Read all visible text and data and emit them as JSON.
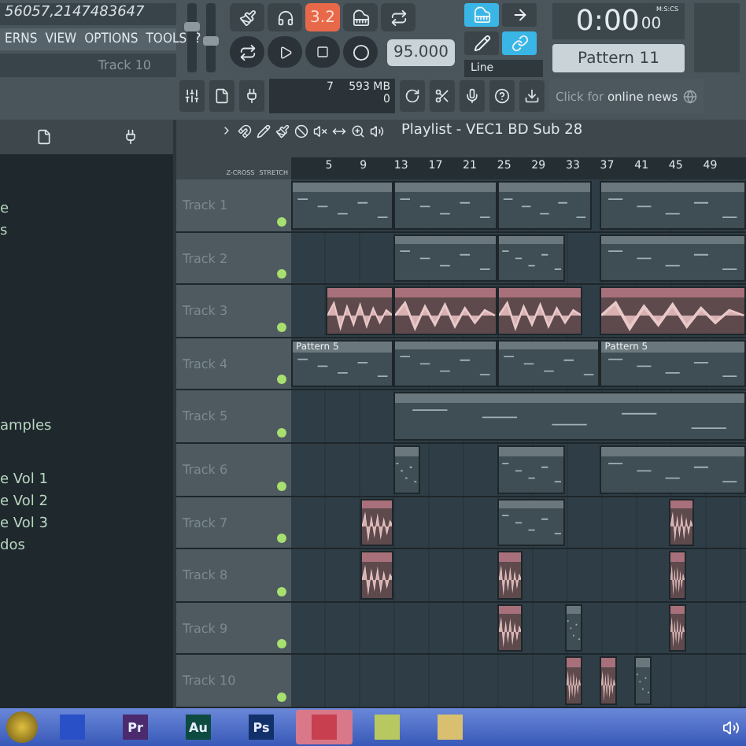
{
  "top_panel": {
    "hint_value": "56057,2147483647",
    "menu": [
      "ERNS",
      "VIEW",
      "OPTIONS",
      "TOOLS",
      "?"
    ],
    "hint_bar": "Track 10"
  },
  "sliders": [
    {
      "level": 0.65
    },
    {
      "level": 0.45
    }
  ],
  "transport": {
    "buttons": [
      {
        "on": false
      },
      {
        "on": false
      },
      {
        "label": "3.2",
        "on": true
      },
      {
        "on": false
      },
      {
        "on": false
      }
    ],
    "tempo": "95.000"
  },
  "tools": {
    "buttons": [
      {
        "on": true
      },
      {
        "on": false
      },
      {
        "on": false
      },
      {
        "on": true
      }
    ],
    "snap": "Line"
  },
  "clock": {
    "time": "0:00",
    "centis": "00",
    "unit": "M:S:CS"
  },
  "pattern": {
    "name": "Pattern 11"
  },
  "meters": {
    "cpu": "7",
    "memory": "593 MB",
    "polyphony": "0"
  },
  "news": "Click for **online news**",
  "browser": {
    "items": [
      {
        "label": "e"
      },
      {
        "label": "s"
      },
      {
        "label": "amples"
      },
      {
        "label": "e Vol 1"
      },
      {
        "label": "e Vol 2"
      },
      {
        "label": "e Vol 3"
      },
      {
        "label": "dos"
      }
    ]
  },
  "playlist": {
    "title": "Playlist - VEC1 BD Sub 28",
    "header_labels": [
      "Z-CROSS",
      "STRETCH"
    ],
    "ruler": [
      "5",
      "9",
      "13",
      "17",
      "21",
      "25",
      "29",
      "33",
      "37",
      "41",
      "45",
      "49"
    ],
    "tracks": [
      {
        "name": "Track 1",
        "clips": [
          {
            "kind": "pattern"
          },
          {
            "kind": "pattern"
          },
          {
            "kind": "pattern"
          },
          {
            "kind": "pattern"
          }
        ]
      },
      {
        "name": "Track 2",
        "clips": [
          {
            "kind": "pattern"
          },
          {
            "kind": "pattern"
          },
          {
            "kind": "pattern"
          }
        ]
      },
      {
        "name": "Track 3",
        "clips": [
          {
            "kind": "audio"
          },
          {
            "kind": "audio"
          },
          {
            "kind": "audio"
          },
          {
            "kind": "audio"
          }
        ]
      },
      {
        "name": "Track 4",
        "clips": [
          {
            "kind": "pattern",
            "label": "Pattern 5"
          },
          {
            "kind": "pattern"
          },
          {
            "kind": "pattern"
          },
          {
            "kind": "pattern",
            "label": "Pattern 5"
          }
        ]
      },
      {
        "name": "Track 5",
        "clips": [
          {
            "kind": "pattern"
          }
        ]
      },
      {
        "name": "Track 6",
        "clips": [
          {
            "kind": "pattern"
          },
          {
            "kind": "pattern"
          },
          {
            "kind": "pattern"
          }
        ]
      },
      {
        "name": "Track 7",
        "clips": [
          {
            "kind": "audio"
          },
          {
            "kind": "pattern"
          },
          {
            "kind": "audio"
          }
        ]
      },
      {
        "name": "Track 8",
        "clips": [
          {
            "kind": "audio"
          },
          {
            "kind": "audio"
          },
          {
            "kind": "audio"
          }
        ]
      },
      {
        "name": "Track 9",
        "clips": [
          {
            "kind": "audio"
          },
          {
            "kind": "pattern"
          },
          {
            "kind": "audio"
          }
        ]
      },
      {
        "name": "Track 10",
        "clips": [
          {
            "kind": "audio"
          },
          {
            "kind": "audio"
          },
          {
            "kind": "pattern"
          }
        ]
      }
    ]
  },
  "taskbar": {
    "items": [
      {
        "kind": "app",
        "color": "#2a50c8",
        "selected": false
      },
      {
        "kind": "app",
        "label": "Pr",
        "color": "#4b2a6e",
        "selected": false
      },
      {
        "kind": "app",
        "label": "Au",
        "color": "#0d4a40",
        "selected": false
      },
      {
        "kind": "app",
        "label": "Ps",
        "color": "#12306a",
        "selected": false
      },
      {
        "kind": "app",
        "color": "#c84050",
        "selected": true
      },
      {
        "kind": "app",
        "color": "#b8c860",
        "selected": false
      },
      {
        "kind": "app",
        "color": "#d8c070",
        "selected": false
      }
    ]
  }
}
